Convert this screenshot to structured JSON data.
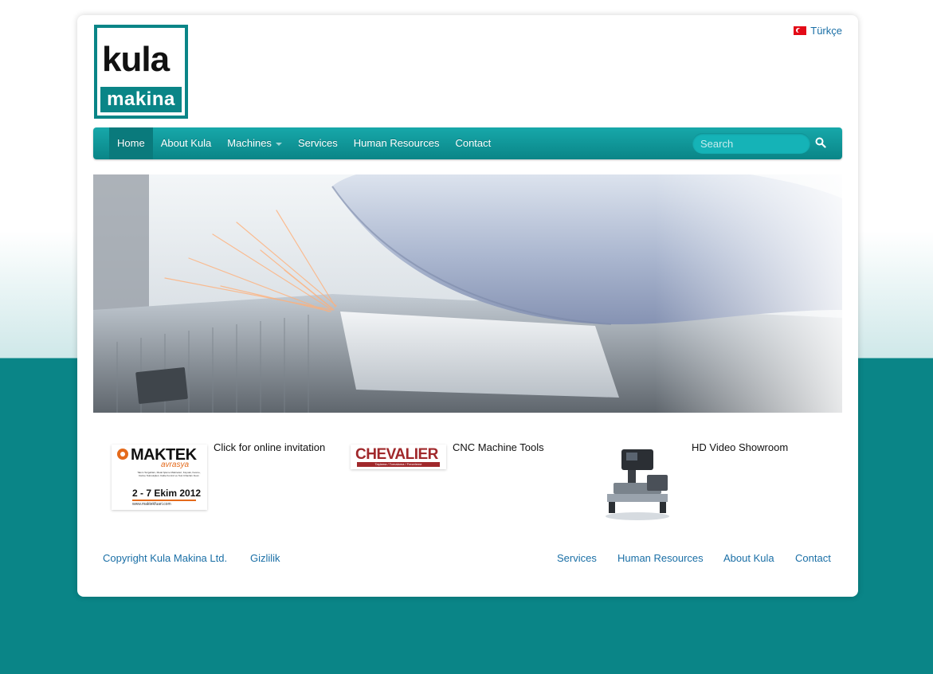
{
  "header": {
    "logo_top": "kula",
    "logo_bottom": "makina",
    "language_label": "Türkçe"
  },
  "nav": {
    "items": [
      {
        "label": "Home",
        "active": true
      },
      {
        "label": "About Kula",
        "active": false
      },
      {
        "label": "Machines",
        "active": false,
        "dropdown": true
      },
      {
        "label": "Services",
        "active": false
      },
      {
        "label": "Human Resources",
        "active": false
      },
      {
        "label": "Contact",
        "active": false
      }
    ],
    "search_placeholder": "Search"
  },
  "features": [
    {
      "label": "Click for online invitation",
      "thumb": {
        "brand": "MAKTEK",
        "subbrand": "avrasya",
        "fineprint": "Takım Tezgahları, Metal İşleme Makineleri, Kaynak, Kesme, Delme Teknolojileri, Kalite Kontrol ve Test Cihazları Fuarı",
        "dates": "2 - 7 Ekim 2012",
        "url": "www.maktekfuari.com"
      }
    },
    {
      "label": "CNC Machine Tools",
      "thumb": {
        "brand": "CHEVALIER",
        "tagline": "Taşlama / Tornalama / Frezeleme"
      }
    },
    {
      "label": "HD Video Showroom",
      "thumb": {}
    }
  ],
  "footer": {
    "copyright": "Copyright Kula Makina Ltd.",
    "privacy": "Gizlilik",
    "links": [
      "Services",
      "Human Resources",
      "About Kula",
      "Contact"
    ]
  },
  "colors": {
    "brand_teal": "#0a8587",
    "link_blue": "#1a6fa6",
    "chevalier_red": "#a0282b"
  }
}
